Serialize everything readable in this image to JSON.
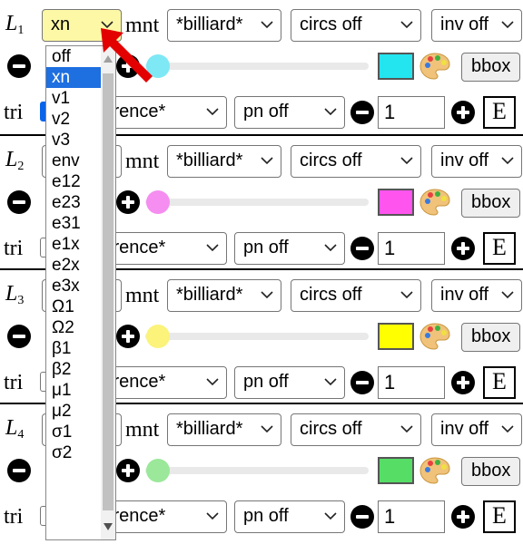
{
  "panels": [
    {
      "label": "L",
      "index": "1",
      "xn_value": "xn",
      "mnt_label": "mnt",
      "billiard": "*billiard*",
      "circs": "circs off",
      "inv": "inv off",
      "color": "#22e5f0",
      "tri_label": "tri",
      "tri_checked": true,
      "reference": "reference*",
      "pn": "pn off",
      "number": "1",
      "e_label": "E",
      "bbox": "bbox"
    },
    {
      "label": "L",
      "index": "2",
      "xn_value": "",
      "mnt_label": "mnt",
      "billiard": "*billiard*",
      "circs": "circs off",
      "inv": "inv off",
      "color": "#ff55ee",
      "tri_label": "tri",
      "tri_checked": false,
      "reference": "reference*",
      "pn": "pn off",
      "number": "1",
      "e_label": "E",
      "bbox": "bbox"
    },
    {
      "label": "L",
      "index": "3",
      "xn_value": "",
      "mnt_label": "mnt",
      "billiard": "*billiard*",
      "circs": "circs off",
      "inv": "inv off",
      "color": "#ffff00",
      "tri_label": "tri",
      "tri_checked": false,
      "reference": "reference*",
      "pn": "pn off",
      "number": "1",
      "e_label": "E",
      "bbox": "bbox"
    },
    {
      "label": "L",
      "index": "4",
      "xn_value": "",
      "mnt_label": "mnt",
      "billiard": "*billiard*",
      "circs": "circs off",
      "inv": "inv off",
      "color": "#55dd66",
      "tri_label": "tri",
      "tri_checked": false,
      "reference": "reference*",
      "pn": "pn off",
      "number": "1",
      "e_label": "E",
      "bbox": "bbox"
    }
  ],
  "slider_thumb_colors": [
    "#7ee8f5",
    "#f58ef0",
    "#fbf37a",
    "#9be89a"
  ],
  "dropdown": {
    "options": [
      "off",
      "xn",
      "v1",
      "v2",
      "v3",
      "env",
      "e12",
      "e23",
      "e31",
      "e1x",
      "e2x",
      "e3x",
      "Ω1",
      "Ω2",
      "β1",
      "β2",
      "μ1",
      "μ2",
      "σ1",
      "σ2"
    ],
    "selected_index": 1
  },
  "icons": {
    "minus": "minus-circle-icon",
    "plus": "plus-circle-icon",
    "palette": "palette-icon",
    "chevron": "chevron-down-icon",
    "pointer": "red-arrow-pointer-icon"
  }
}
